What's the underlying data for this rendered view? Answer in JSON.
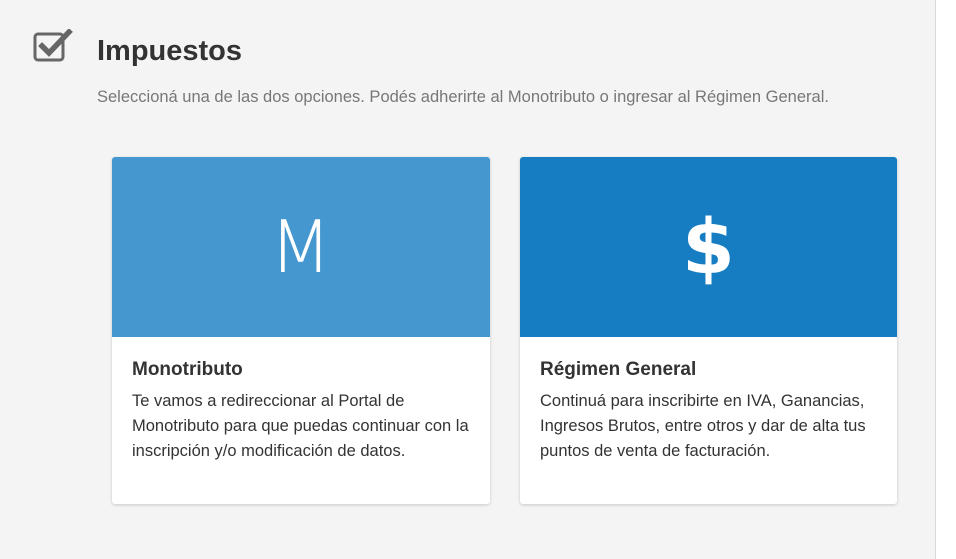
{
  "header": {
    "title": "Impuestos",
    "subtitle": "Seleccioná una de las dos opciones. Podés adherirte al Monotributo o ingresar al Régimen General.",
    "icon": "checkbox-checked-icon"
  },
  "options": [
    {
      "banner": "M",
      "banner_color": "#4597cf",
      "title": "Monotributo",
      "description": "Te vamos a redireccionar al Portal de Monotributo para que puedas continuar con la inscripción y/o modificación de datos."
    },
    {
      "banner": "$",
      "banner_color": "#177dc2",
      "title": "Régimen General",
      "description": "Continuá para inscribirte en IVA, Ganancias, Ingresos Brutos, entre otros y dar de alta tus puntos de venta de facturación."
    }
  ],
  "colors": {
    "background": "#f4f4f4",
    "text": "#333333",
    "muted_text": "#777777"
  }
}
